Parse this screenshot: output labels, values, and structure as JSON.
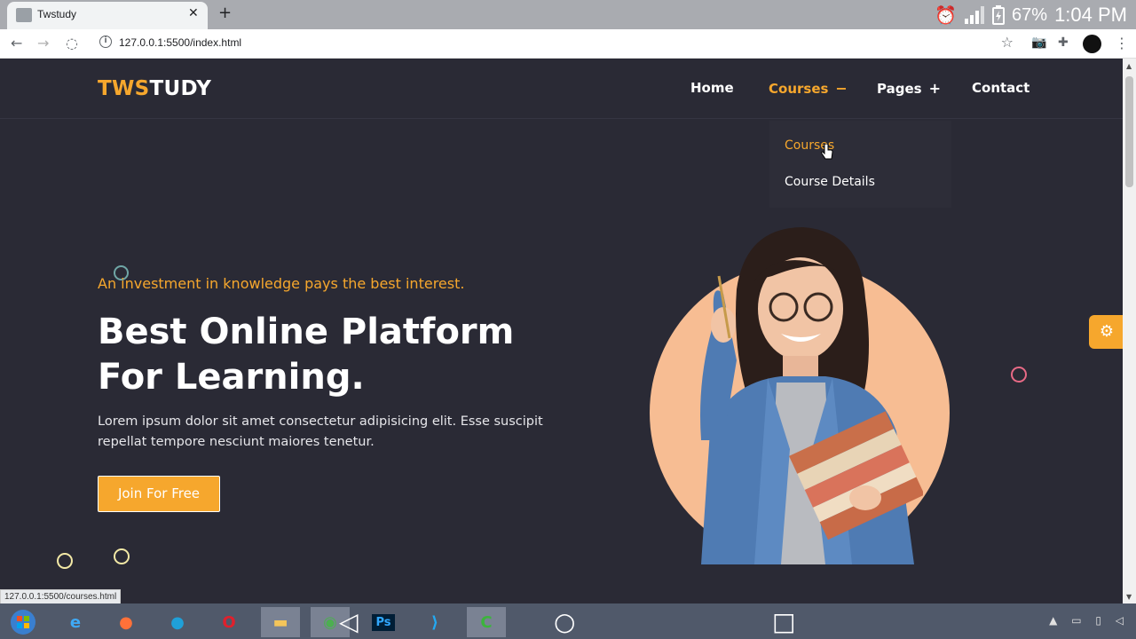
{
  "browser": {
    "tab_title": "Twstudy",
    "tab_close": "✕",
    "new_tab": "+",
    "url": "127.0.0.1:5500/index.html",
    "status_url": "127.0.0.1:5500/courses.html"
  },
  "android_status": {
    "battery_percent": "67%",
    "time": "1:04 PM"
  },
  "site": {
    "logo_part1": "TWS",
    "logo_part2": "TUDY",
    "nav": {
      "home": "Home",
      "courses": "Courses",
      "courses_toggle": "−",
      "pages": "Pages",
      "pages_toggle": "+",
      "contact": "Contact"
    },
    "dropdown": {
      "items": [
        "Courses",
        "Course Details"
      ]
    },
    "hero": {
      "tagline": "An investment in knowledge pays the best interest.",
      "headline_line1": "Best Online Platform",
      "headline_line2": "For Learning.",
      "description": "Lorem ipsum dolor sit amet consectetur adipisicing elit. Esse suscipit repellat tempore nesciunt maiores tenetur.",
      "cta_label": "Join For Free"
    }
  },
  "colors": {
    "accent": "#f6a72d",
    "background": "#2a2a35",
    "hero_circle": "#f7bd93"
  }
}
